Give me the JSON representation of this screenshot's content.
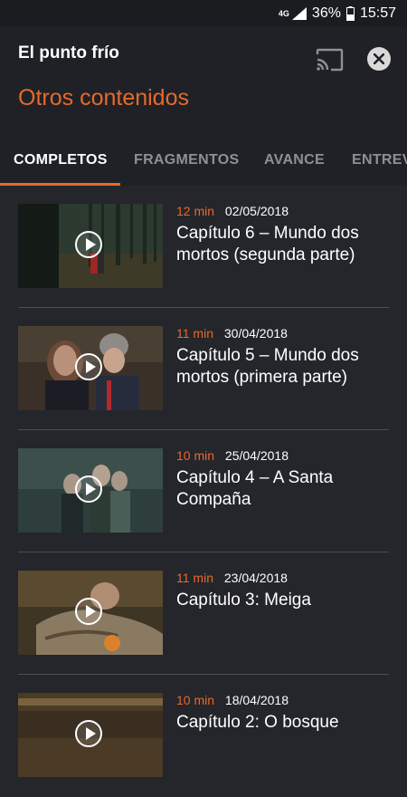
{
  "status_bar": {
    "network": "4G",
    "battery": "36%",
    "time": "15:57"
  },
  "header": {
    "app_title": "El punto frío",
    "section_title": "Otros contenidos"
  },
  "tabs": [
    {
      "label": "COMPLETOS",
      "active": true
    },
    {
      "label": "FRAGMENTOS",
      "active": false
    },
    {
      "label": "AVANCE",
      "active": false
    },
    {
      "label": "ENTREV",
      "active": false
    }
  ],
  "episodes": [
    {
      "duration": "12 min",
      "date": "02/05/2018",
      "title": "Capítulo 6 – Mundo dos mortos (segunda parte)"
    },
    {
      "duration": "11 min",
      "date": "30/04/2018",
      "title": "Capítulo 5 – Mundo dos mortos (primera parte)"
    },
    {
      "duration": "10 min",
      "date": "25/04/2018",
      "title": "Capítulo 4 – A Santa Compaña"
    },
    {
      "duration": "11 min",
      "date": "23/04/2018",
      "title": "Capítulo 3: Meiga"
    },
    {
      "duration": "10 min",
      "date": "18/04/2018",
      "title": "Capítulo 2: O bosque"
    }
  ],
  "colors": {
    "accent": "#e8692b",
    "background": "#24262b",
    "header": "#1f2126"
  },
  "icons": {
    "cast": "cast-icon",
    "close": "close-icon",
    "play": "play-icon"
  }
}
